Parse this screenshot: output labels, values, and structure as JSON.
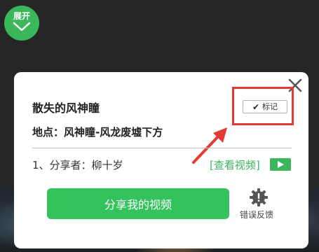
{
  "expand": {
    "label": "展开"
  },
  "card": {
    "title": "散失的风神瞳",
    "location": "地点：风神瞳-风龙废墟下方",
    "mark": {
      "check": "✔",
      "label": "标记"
    },
    "sharer": "1、分享者：柳十岁",
    "watch_link": "[查看视频]",
    "share_button": "分享我的视频",
    "error_report": "错误反馈"
  },
  "colors": {
    "accent": "#3bb65a",
    "highlight": "#e53935"
  },
  "icons": [
    "chevron-down-icon",
    "close-icon",
    "check-icon",
    "play-icon",
    "gear-alert-icon",
    "arrow-icon"
  ]
}
